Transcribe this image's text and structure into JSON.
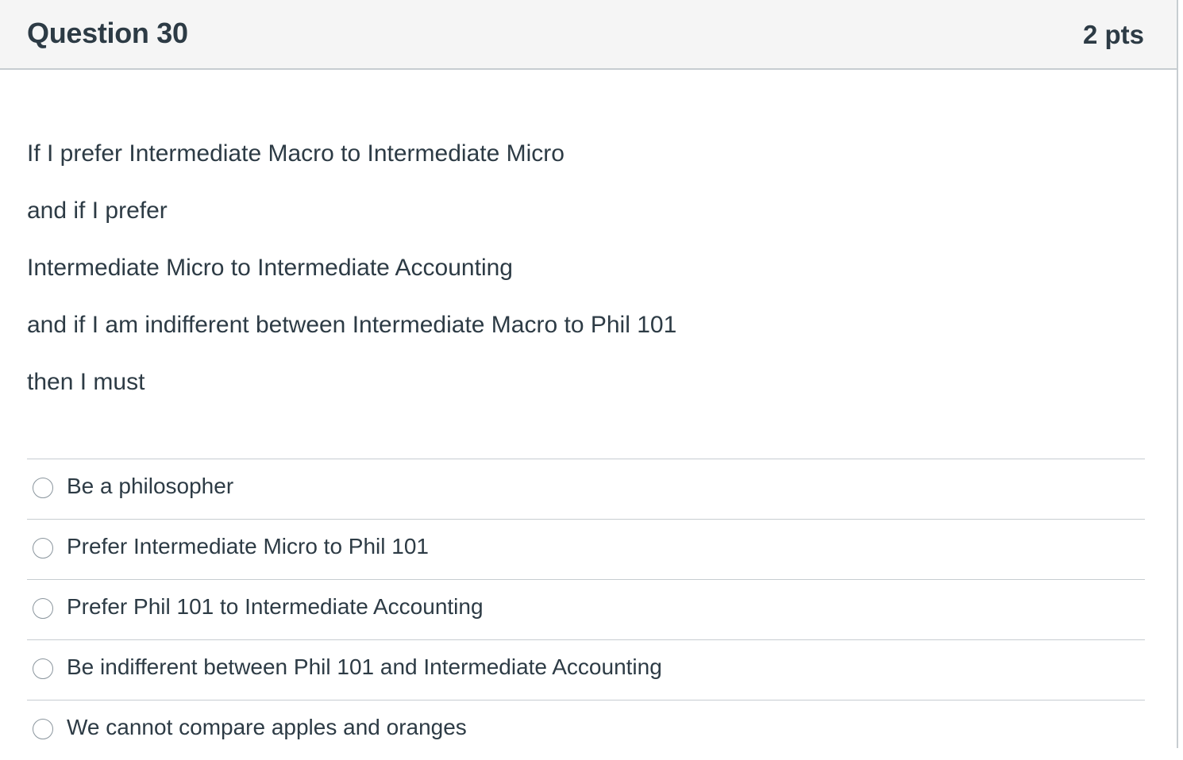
{
  "question": {
    "title": "Question 30",
    "points": "2 pts",
    "lines": [
      "If I prefer Intermediate Macro to Intermediate Micro",
      "and if I prefer",
      "Intermediate Micro to Intermediate Accounting",
      "and if I am indifferent between Intermediate Macro to Phil 101",
      "then I must"
    ]
  },
  "answers": [
    {
      "label": "Be a philosopher",
      "selected": false
    },
    {
      "label": "Prefer Intermediate Micro to Phil 101",
      "selected": false
    },
    {
      "label": "Prefer Phil 101 to Intermediate Accounting",
      "selected": false
    },
    {
      "label": "Be indifferent between Phil 101 and Intermediate Accounting",
      "selected": false
    },
    {
      "label": "We cannot compare apples and oranges",
      "selected": false
    }
  ],
  "colors": {
    "header_background": "#f5f5f5",
    "border": "#c7cdd1",
    "text": "#2d3b45",
    "radio_border": "#8b969e"
  }
}
